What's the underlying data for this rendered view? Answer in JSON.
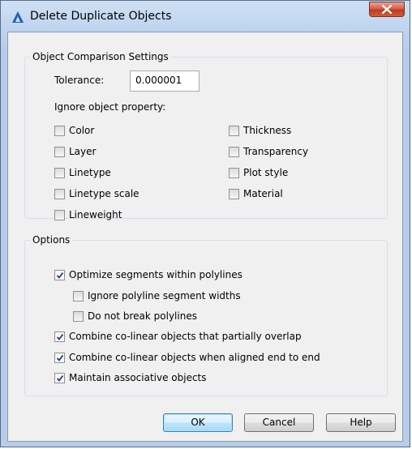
{
  "window": {
    "title": "Delete Duplicate Objects",
    "close_symbol": "X"
  },
  "comparison": {
    "legend": "Object Comparison Settings",
    "tolerance_label": "Tolerance:",
    "tolerance_value": "0.000001",
    "ignore_label": "Ignore object property:",
    "properties": {
      "color": {
        "label": "Color",
        "checked": false
      },
      "layer": {
        "label": "Layer",
        "checked": false
      },
      "linetype": {
        "label": "Linetype",
        "checked": false
      },
      "linetype_scale": {
        "label": "Linetype scale",
        "checked": false
      },
      "lineweight": {
        "label": "Lineweight",
        "checked": false
      },
      "thickness": {
        "label": "Thickness",
        "checked": false
      },
      "transparency": {
        "label": "Transparency",
        "checked": false
      },
      "plot_style": {
        "label": "Plot style",
        "checked": false
      },
      "material": {
        "label": "Material",
        "checked": false
      }
    }
  },
  "options": {
    "legend": "Options",
    "optimize_segments": {
      "label": "Optimize segments within polylines",
      "checked": true
    },
    "ignore_widths": {
      "label": "Ignore polyline segment widths",
      "checked": false
    },
    "no_break": {
      "label": "Do not break polylines",
      "checked": false
    },
    "combine_overlap": {
      "label": "Combine co-linear objects that partially overlap",
      "checked": true
    },
    "combine_end": {
      "label": "Combine co-linear objects when aligned end to end",
      "checked": true
    },
    "maintain_assoc": {
      "label": "Maintain associative objects",
      "checked": true
    }
  },
  "buttons": {
    "ok": "OK",
    "cancel": "Cancel",
    "help": "Help"
  },
  "colors": {
    "accent": "#1f5fb5",
    "close_button": "#c7492b"
  }
}
